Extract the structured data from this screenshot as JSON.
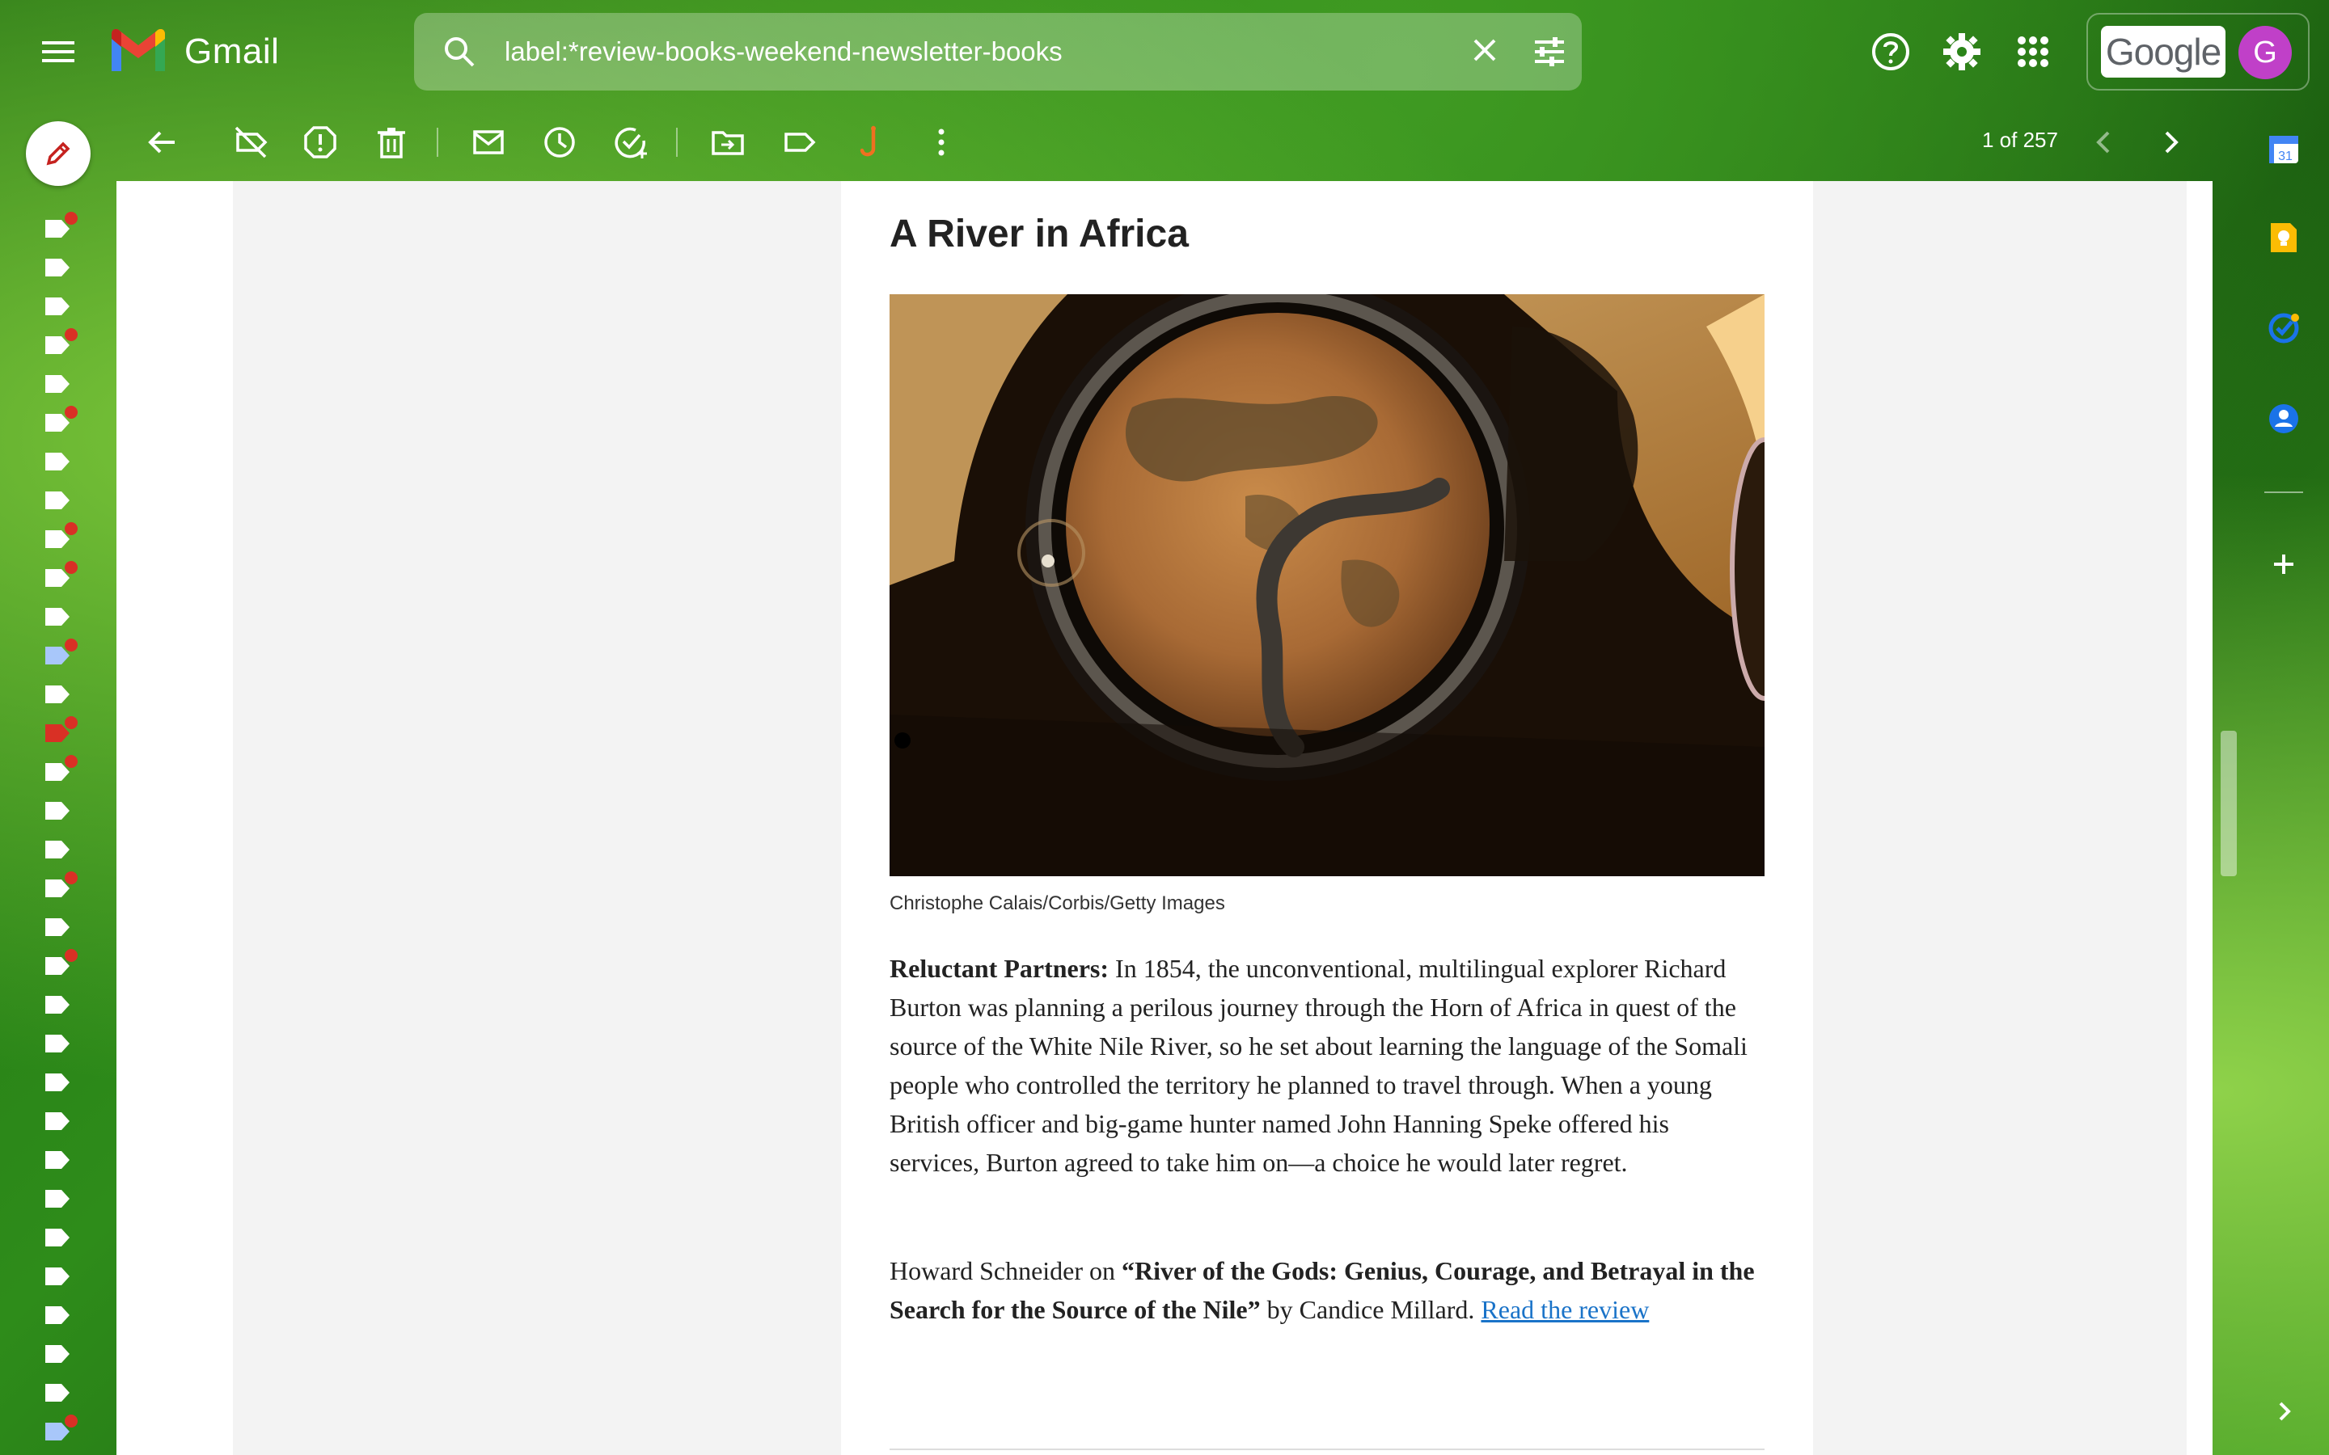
{
  "app": {
    "name": "Gmail"
  },
  "search": {
    "query": "label:*review-books-weekend-newsletter-books"
  },
  "account": {
    "brand": "Google",
    "avatar_letter": "G"
  },
  "toolbar": {
    "page_count": "1 of 257"
  },
  "email": {
    "title": "A River in Africa",
    "photo_credit": "Christophe Calais/Corbis/Getty Images",
    "para1_bold": "Reluctant Partners:",
    "para1_text": " In 1854, the unconventional, multilingual explorer Richard Burton was planning a perilous journey through the Horn of Africa in quest of the source of the White Nile River, so he set about learning the language of the Somali people who controlled the territory he planned to travel through. When a young British officer and big-game hunter named John Hanning Speke offered his services, Burton agreed to take him on—a choice he would later regret.",
    "para2_pre": "Howard Schneider on ",
    "para2_book": "“River of the Gods: Genius, Courage, and Betrayal in the Search for the Source of the Nile”",
    "para2_post": " by Candice Millard. ",
    "para2_link": "Read the review"
  },
  "icons": {
    "top": [
      "menu-icon",
      "gmail-logo",
      "search-icon",
      "clear-icon",
      "tune-icon",
      "help-icon",
      "gear-icon",
      "apps-grid-icon"
    ],
    "toolbar": [
      "back-arrow-icon",
      "label-off-icon",
      "report-spam-icon",
      "delete-icon",
      "mark-unread-icon",
      "snooze-icon",
      "add-task-icon",
      "move-to-icon",
      "label-icon",
      "hook-icon",
      "more-vert-icon",
      "chevron-left-icon",
      "chevron-right-icon"
    ],
    "side": [
      "calendar-icon",
      "keep-icon",
      "tasks-icon",
      "contacts-icon",
      "plus-icon",
      "chevron-right-icon"
    ]
  },
  "colors": {
    "accent_red": "#d93025",
    "link": "#1a73c8",
    "avatar": "#c040c8"
  }
}
